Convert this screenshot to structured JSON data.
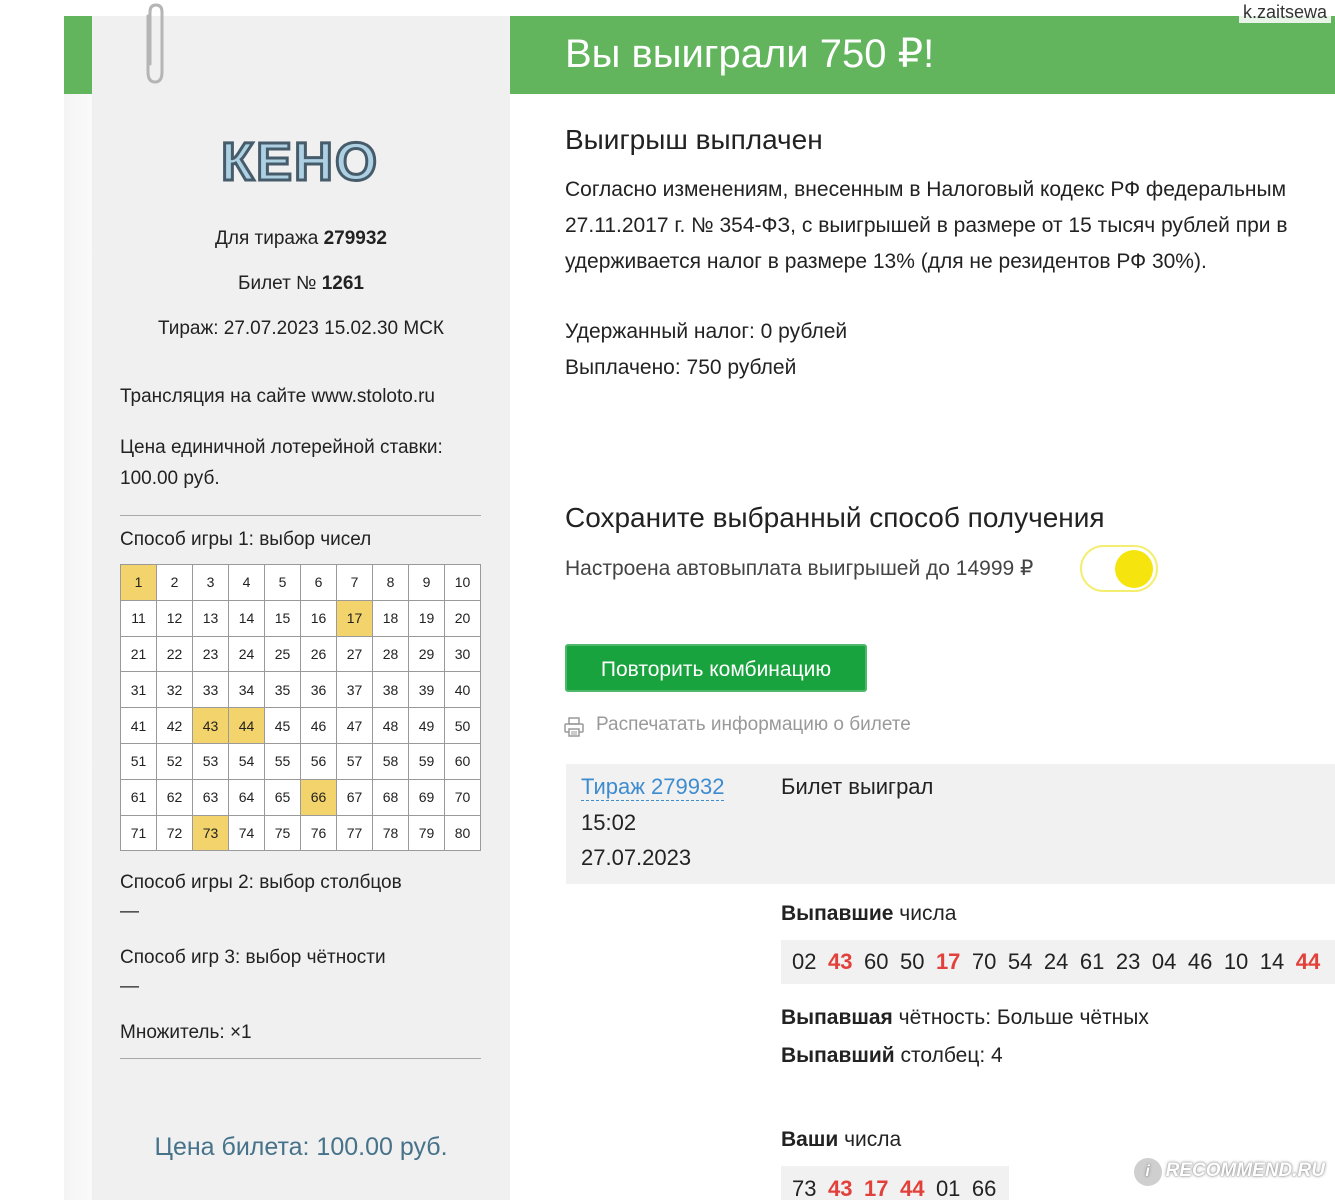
{
  "watermarks": {
    "author": "k.zaitsewa",
    "site": "RECOMMEND.RU"
  },
  "ticket": {
    "logo": "КЕНО",
    "draw_label": "Для тиража",
    "draw_number": "279932",
    "ticket_label": "Билет №",
    "ticket_number": "1261",
    "draw_datetime": "Тираж: 27.07.2023 15.02.30 МСК",
    "broadcast": "Трансляция на сайте www.stoloto.ru",
    "bet_price_label": "Цена единичной лотерейной ставки:",
    "bet_price_value": "100.00 руб.",
    "mode1": "Способ игры 1: выбор чисел",
    "grid_numbers": [
      1,
      2,
      3,
      4,
      5,
      6,
      7,
      8,
      9,
      10,
      11,
      12,
      13,
      14,
      15,
      16,
      17,
      18,
      19,
      20,
      21,
      22,
      23,
      24,
      25,
      26,
      27,
      28,
      29,
      30,
      31,
      32,
      33,
      34,
      35,
      36,
      37,
      38,
      39,
      40,
      41,
      42,
      43,
      44,
      45,
      46,
      47,
      48,
      49,
      50,
      51,
      52,
      53,
      54,
      55,
      56,
      57,
      58,
      59,
      60,
      61,
      62,
      63,
      64,
      65,
      66,
      67,
      68,
      69,
      70,
      71,
      72,
      73,
      74,
      75,
      76,
      77,
      78,
      79,
      80
    ],
    "selected_numbers": [
      1,
      17,
      43,
      44,
      66,
      73
    ],
    "selected_color": "#f3d36b",
    "mode2": "Способ игры 2: выбор столбцов",
    "mode2_value": "—",
    "mode3": "Способ игр 3: выбор чётности",
    "mode3_value": "—",
    "multiplier": "Множитель: ×1",
    "ticket_price": "Цена билета: 100.00 руб."
  },
  "result": {
    "banner_title": "Вы выиграли 750 ₽!",
    "banner_color": "#62b55d",
    "payout_title": "Выигрыш выплачен",
    "tax_lines": [
      "Согласно изменениям, внесенным в Налоговый кодекс РФ федеральным",
      "27.11.2017 г. № 354-ФЗ, с выигрышей в размере от 15 тысяч рублей при в",
      "удерживается налог в размере 13% (для не резидентов РФ 30%)."
    ],
    "tax_withheld": "Удержанный налог: 0 рублей",
    "paid": "Выплачено: 750 рублей",
    "save_title": "Сохраните выбранный способ получения",
    "auto_payout": "Настроена автовыплата выигрышей до 14999 ₽",
    "auto_payout_enabled": true,
    "repeat_button": "Повторить комбинацию",
    "print_link": "Распечатать информацию о билете",
    "draw_link": "Тираж 279932",
    "draw_time": "15:02",
    "draw_date": "27.07.2023",
    "ticket_status": "Билет выиграл",
    "drawn_label_bold": "Выпавшие",
    "drawn_label_rest": " числа",
    "drawn_numbers": [
      "02",
      "43",
      "60",
      "50",
      "17",
      "70",
      "54",
      "24",
      "61",
      "23",
      "04",
      "46",
      "10",
      "14",
      "44"
    ],
    "parity_label_bold": "Выпавшая",
    "parity_label_rest": " чётность: Больше чётных",
    "column_label_bold": "Выпавший",
    "column_label_rest": " столбец: 4",
    "your_label_bold": "Ваши",
    "your_label_rest": " числа",
    "your_numbers": [
      "73",
      "43",
      "17",
      "44",
      "01",
      "66"
    ],
    "hit_color": "#e2413b"
  }
}
